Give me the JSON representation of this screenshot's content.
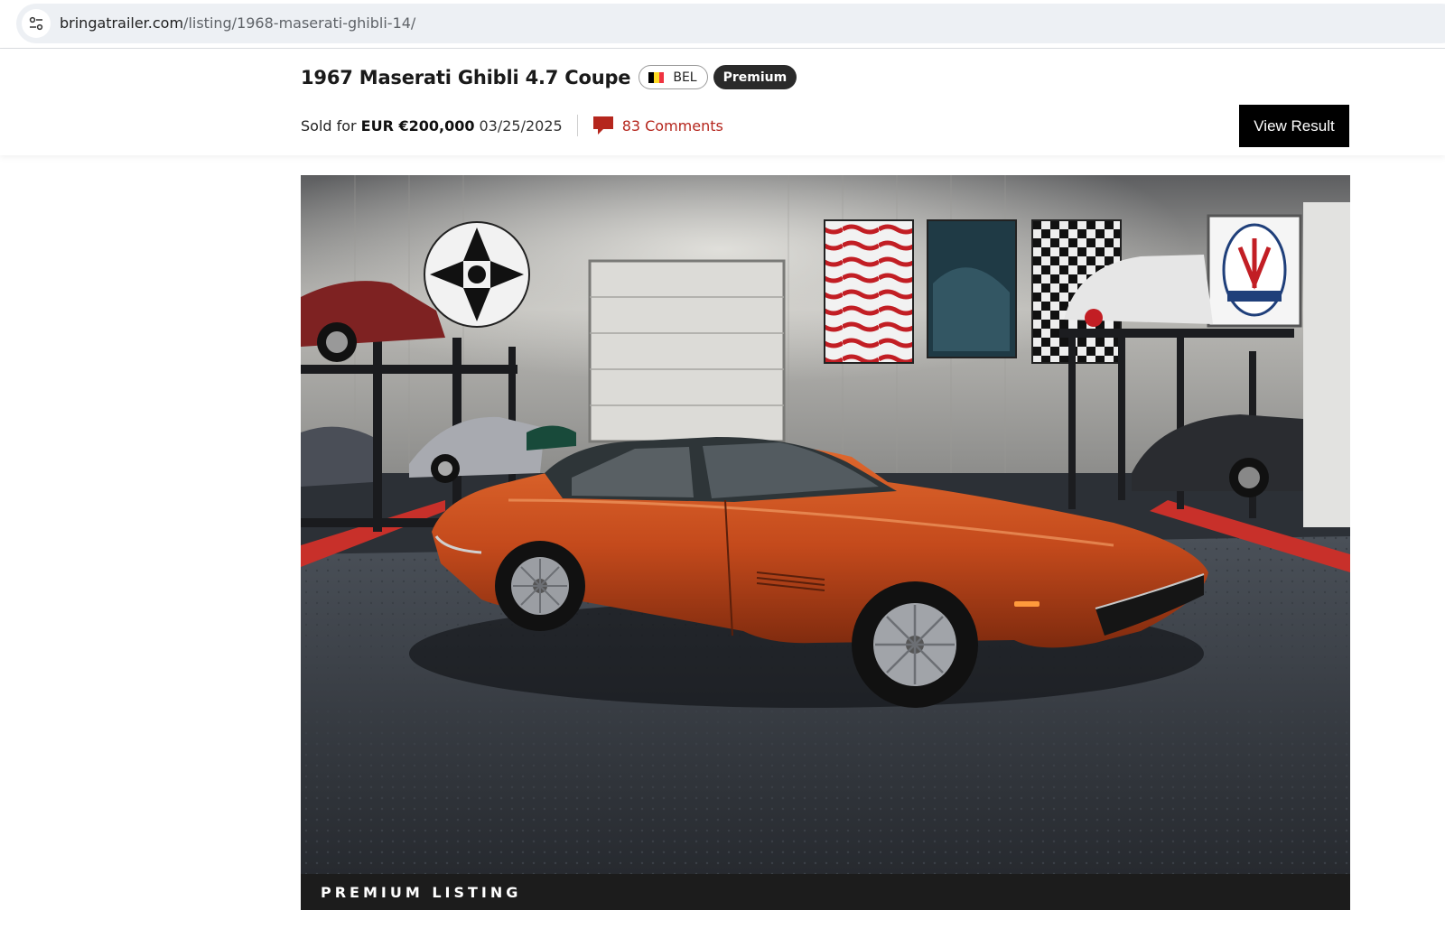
{
  "browser": {
    "url_domain": "bringatrailer.com",
    "url_path": "/listing/1968-maserati-ghibli-14/",
    "site_info_icon": "tune-icon"
  },
  "listing": {
    "title": "1967 Maserati Ghibli 4.7 Coupe",
    "country_code": "BEL",
    "country_flag_colors": [
      "#000000",
      "#fdda24",
      "#ef3340"
    ],
    "premium_badge": "Premium",
    "sold_label": "Sold for",
    "sold_price": "EUR €200,000",
    "sold_date": "03/25/2025",
    "comments_label": "83 Comments",
    "comment_icon": "speech-bubble-icon",
    "view_result_label": "View Result",
    "accent_color": "#b5261d"
  },
  "hero": {
    "banner_text": "PREMIUM LISTING",
    "car_color": "#c44a1c",
    "wall_logo_text": "MASERATI"
  }
}
